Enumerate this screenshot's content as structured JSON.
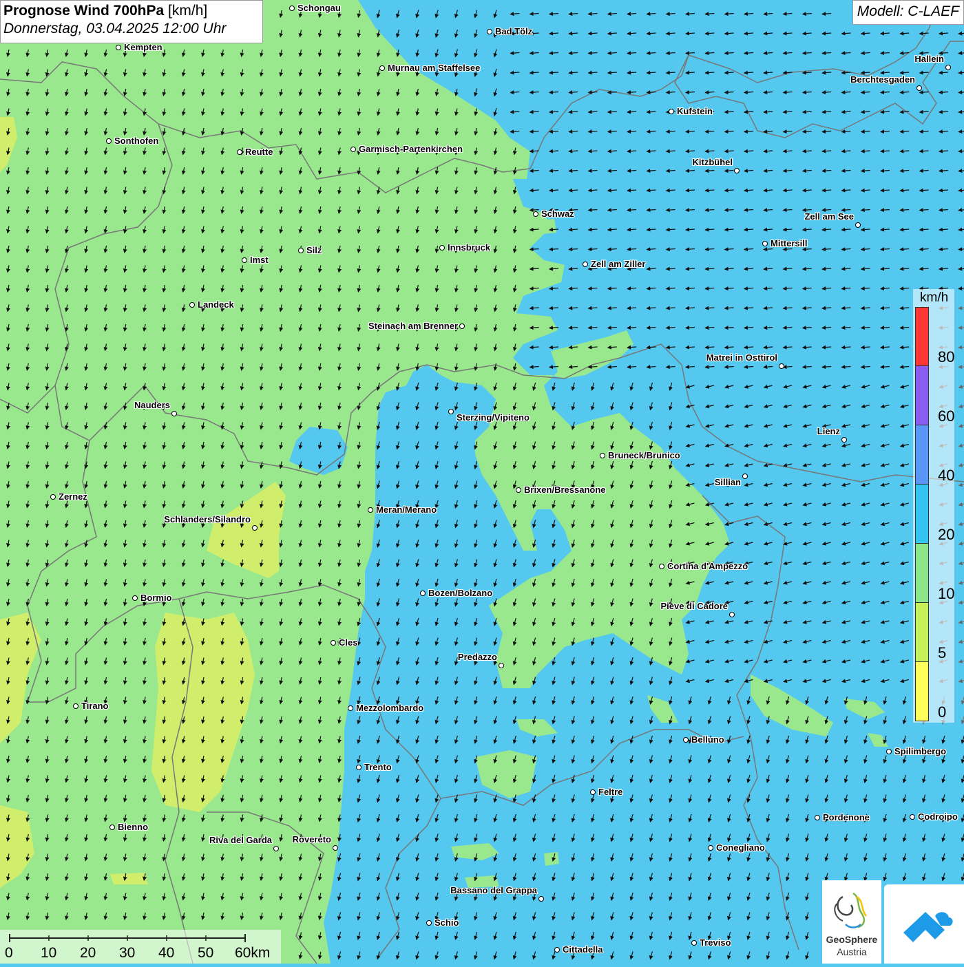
{
  "header": {
    "title_bold": "Prognose Wind 700hPa",
    "title_unit": "[km/h]",
    "datetime": "Donnerstag, 03.04.2025 12:00 Uhr"
  },
  "model_label": "Modell: C-LAEF",
  "legend": {
    "unit": "km/h",
    "colors": [
      "#ff3636",
      "#8a5cf0",
      "#5a96f5",
      "#33c4f2",
      "#8ee68a",
      "#c6f05a",
      "#ffff5a"
    ],
    "ticks": [
      "80",
      "60",
      "40",
      "20",
      "10",
      "5",
      "0"
    ]
  },
  "scale_bar": {
    "ticks": [
      "0",
      "10",
      "20",
      "30",
      "40",
      "50",
      "60km"
    ]
  },
  "logos": {
    "geosphere_line1": "GeoSphere",
    "geosphere_line2": "Austria"
  },
  "cities": [
    {
      "name": "Schongau"
    },
    {
      "name": "Bad Tölz"
    },
    {
      "name": "Kempten"
    },
    {
      "name": "Murnau am Staffelsee"
    },
    {
      "name": "Hallein"
    },
    {
      "name": "Berchtesgaden"
    },
    {
      "name": "Kufstein"
    },
    {
      "name": "Sonthofen"
    },
    {
      "name": "Reutte"
    },
    {
      "name": "Garmisch-Partenkirchen"
    },
    {
      "name": "Kitzbühel"
    },
    {
      "name": "Schwaz"
    },
    {
      "name": "Zell am See"
    },
    {
      "name": "Mittersill"
    },
    {
      "name": "Innsbruck"
    },
    {
      "name": "Silz"
    },
    {
      "name": "Imst"
    },
    {
      "name": "Zell am Ziller"
    },
    {
      "name": "Landeck"
    },
    {
      "name": "Steinach am Brenner"
    },
    {
      "name": "Matrei in Osttirol"
    },
    {
      "name": "Nauders"
    },
    {
      "name": "Sterzing/Vipiteno"
    },
    {
      "name": "Lienz"
    },
    {
      "name": "Bruneck/Brunico"
    },
    {
      "name": "Sillian"
    },
    {
      "name": "Brixen/Bressanone"
    },
    {
      "name": "Zernez"
    },
    {
      "name": "Meran/Merano"
    },
    {
      "name": "Schlanders/Silandro"
    },
    {
      "name": "Cortina d'Ampezzo"
    },
    {
      "name": "Bozen/Bolzano"
    },
    {
      "name": "Bormio"
    },
    {
      "name": "Pieve di Cadore"
    },
    {
      "name": "Cles"
    },
    {
      "name": "Predazzo"
    },
    {
      "name": "Tirano"
    },
    {
      "name": "Mezzolombardo"
    },
    {
      "name": "Belluno"
    },
    {
      "name": "Spilimbergo"
    },
    {
      "name": "Trento"
    },
    {
      "name": "Feltre"
    },
    {
      "name": "Pordenone"
    },
    {
      "name": "Codroipo"
    },
    {
      "name": "Bienno"
    },
    {
      "name": "Riva del Garda"
    },
    {
      "name": "Rovereto"
    },
    {
      "name": "Conegliano"
    },
    {
      "name": "Bassano del Grappa"
    },
    {
      "name": "Schio"
    },
    {
      "name": "Treviso"
    },
    {
      "name": "Cittadella"
    }
  ]
}
